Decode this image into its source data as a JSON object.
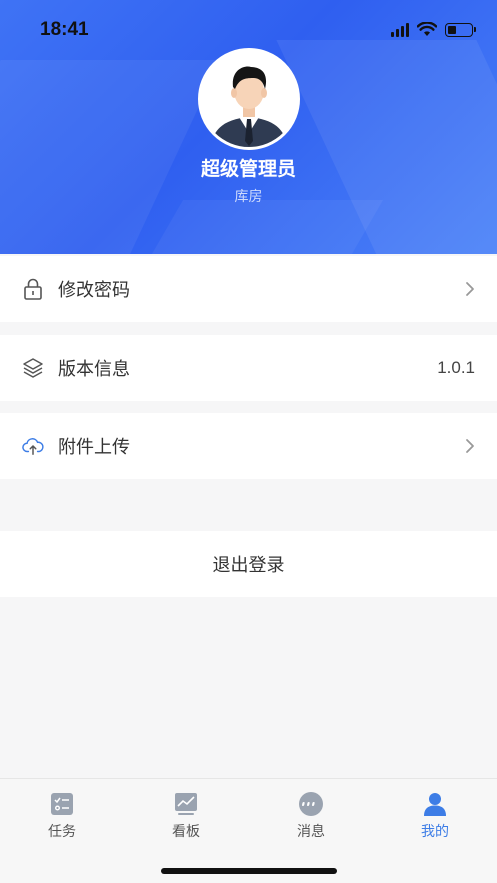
{
  "status_bar": {
    "time": "18:41"
  },
  "profile": {
    "name": "超级管理员",
    "department": "库房"
  },
  "menu": {
    "change_password": {
      "label": "修改密码",
      "icon": "lock-icon"
    },
    "version_info": {
      "label": "版本信息",
      "value": "1.0.1",
      "icon": "layers-icon"
    },
    "attachment_upload": {
      "label": "附件上传",
      "icon": "cloud-upload-icon"
    }
  },
  "logout": {
    "label": "退出登录"
  },
  "tabbar": {
    "tabs": [
      {
        "label": "任务",
        "icon": "task-list-icon",
        "active": false
      },
      {
        "label": "看板",
        "icon": "dashboard-chart-icon",
        "active": false
      },
      {
        "label": "消息",
        "icon": "message-bubble-icon",
        "active": false
      },
      {
        "label": "我的",
        "icon": "person-icon",
        "active": true
      }
    ]
  },
  "colors": {
    "header_blue": "#3366f2",
    "accent": "#3d7de6",
    "text": "#333333"
  }
}
